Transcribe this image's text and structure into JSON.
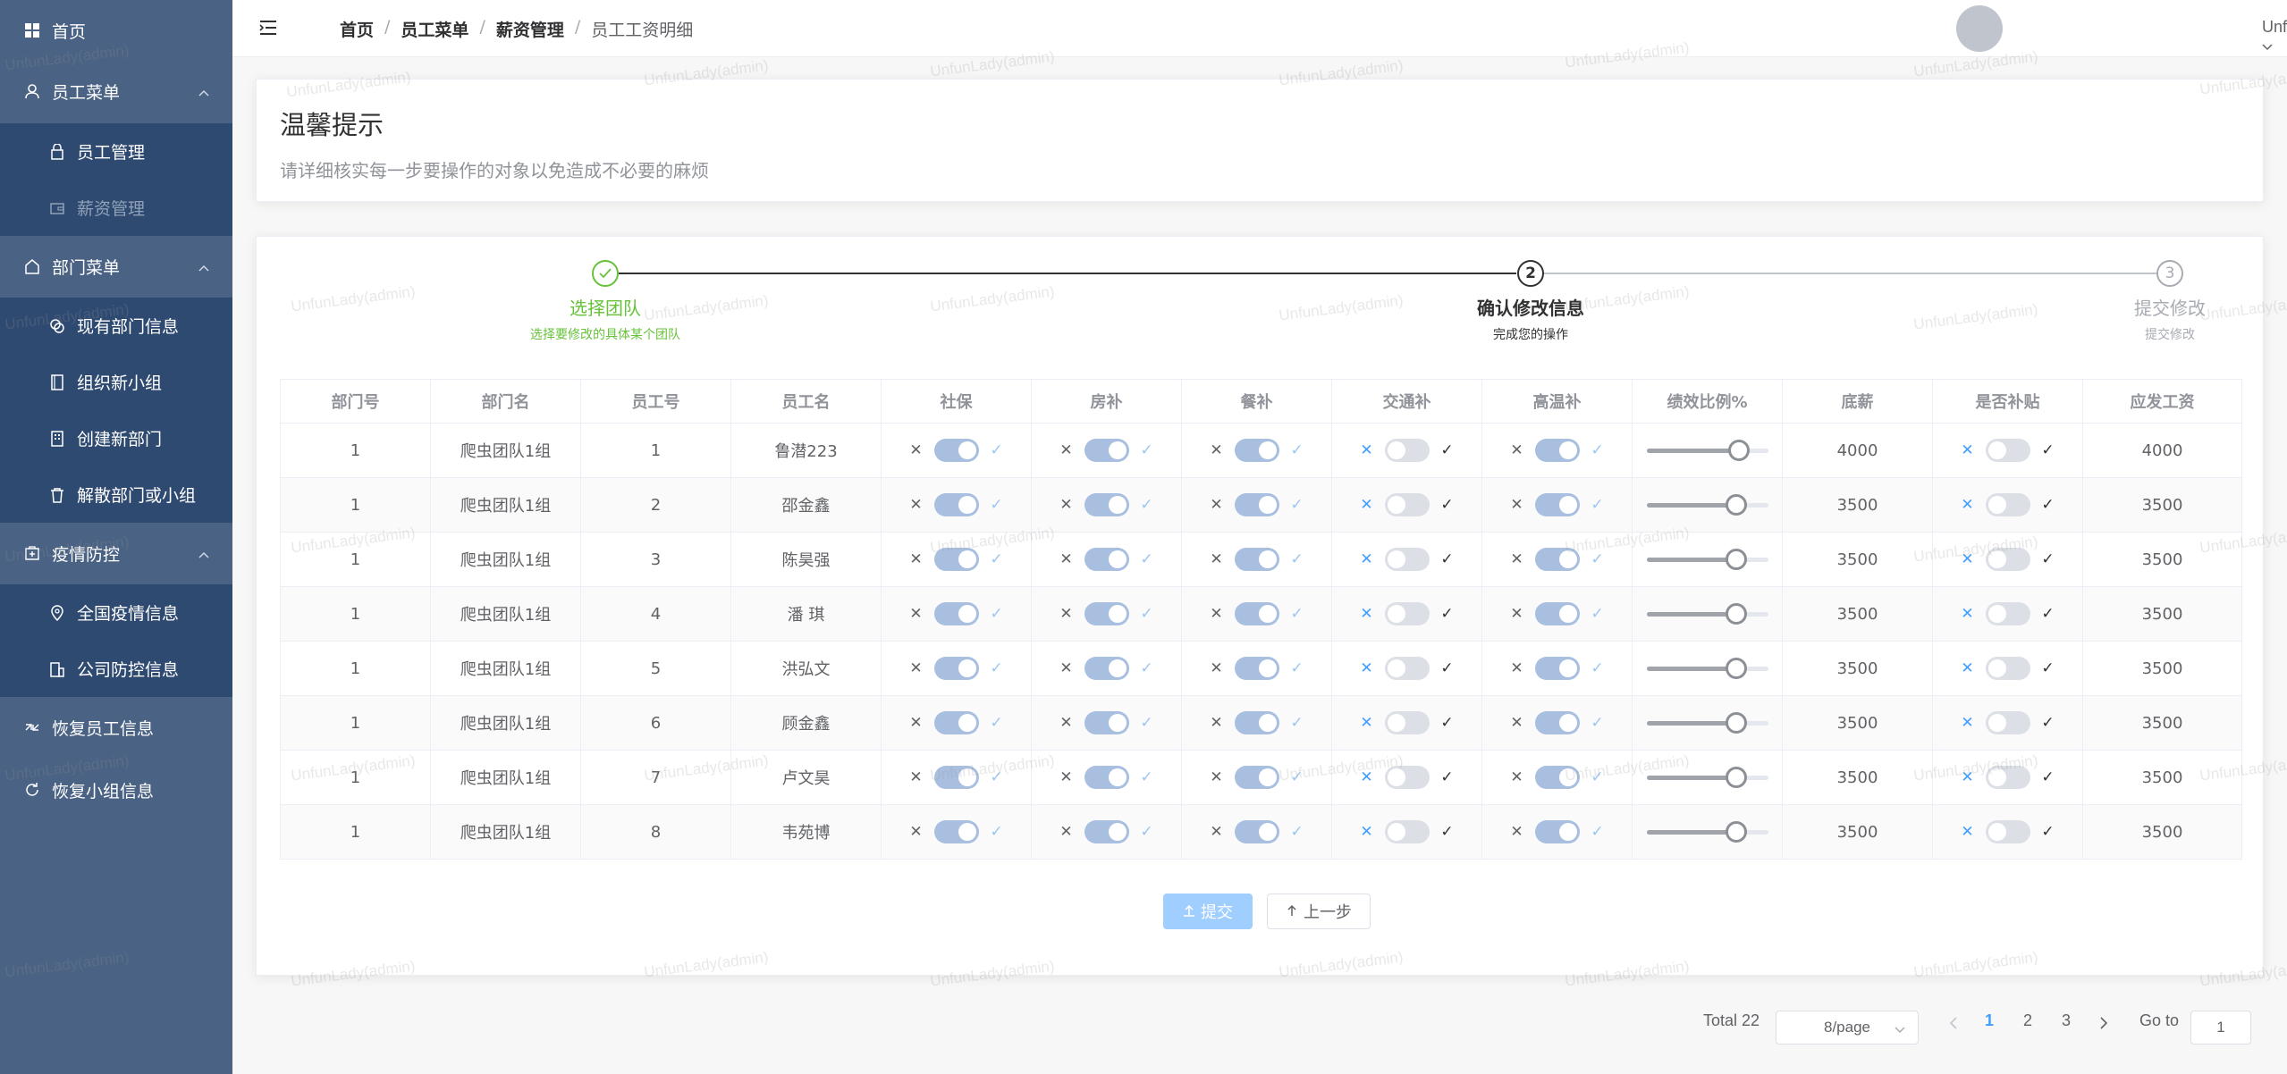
{
  "sidebar": {
    "items": [
      {
        "label": "首页",
        "icon": "grid-icon"
      },
      {
        "label": "员工菜单",
        "icon": "user-icon"
      },
      {
        "label": "员工管理",
        "icon": "lock-icon"
      },
      {
        "label": "薪资管理",
        "icon": "wallet-icon"
      },
      {
        "label": "部门菜单",
        "icon": "home-icon"
      },
      {
        "label": "现有部门信息",
        "icon": "coin-icon"
      },
      {
        "label": "组织新小组",
        "icon": "book-icon"
      },
      {
        "label": "创建新部门",
        "icon": "building-icon"
      },
      {
        "label": "解散部门或小组",
        "icon": "trash-icon"
      },
      {
        "label": "疫情防控",
        "icon": "medical-box-icon"
      },
      {
        "label": "全国疫情信息",
        "icon": "location-icon"
      },
      {
        "label": "公司防控信息",
        "icon": "office-icon"
      },
      {
        "label": "恢复员工信息",
        "icon": "share-icon"
      },
      {
        "label": "恢复小组信息",
        "icon": "refresh-icon"
      }
    ]
  },
  "watermark": "UnfunLady(admin)",
  "header": {
    "breadcrumb": [
      "首页",
      "员工菜单",
      "薪资管理",
      "员工工资明细"
    ],
    "separator": "/",
    "username": "UnfunLady"
  },
  "tip": {
    "title": "温馨提示",
    "text": "请详细核实每一步要操作的对象以免造成不必要的麻烦"
  },
  "steps": [
    {
      "number": "1",
      "title": "选择团队",
      "desc": "选择要修改的具体某个团队",
      "status": "success"
    },
    {
      "number": "2",
      "title": "确认修改信息",
      "desc": "完成您的操作",
      "status": "process"
    },
    {
      "number": "3",
      "title": "提交修改",
      "desc": "提交修改",
      "status": "wait"
    }
  ],
  "table": {
    "headers": [
      "部门号",
      "部门名",
      "员工号",
      "员工名",
      "社保",
      "房补",
      "餐补",
      "交通补",
      "高温补",
      "绩效比例%",
      "底薪",
      "是否补贴",
      "应发工资"
    ],
    "rows": [
      {
        "dept_no": "1",
        "dept_name": "爬虫团队1组",
        "emp_no": "1",
        "emp_name": "鲁潜223",
        "social": true,
        "housing": true,
        "meal": true,
        "transport": false,
        "heat": true,
        "perf": 0.76,
        "base": "4000",
        "subsidy": false,
        "pay": "4000"
      },
      {
        "dept_no": "1",
        "dept_name": "爬虫团队1组",
        "emp_no": "2",
        "emp_name": "邵金鑫",
        "social": true,
        "housing": true,
        "meal": true,
        "transport": false,
        "heat": true,
        "perf": 0.74,
        "base": "3500",
        "subsidy": false,
        "pay": "3500"
      },
      {
        "dept_no": "1",
        "dept_name": "爬虫团队1组",
        "emp_no": "3",
        "emp_name": "陈昊强",
        "social": true,
        "housing": true,
        "meal": true,
        "transport": false,
        "heat": true,
        "perf": 0.74,
        "base": "3500",
        "subsidy": false,
        "pay": "3500"
      },
      {
        "dept_no": "1",
        "dept_name": "爬虫团队1组",
        "emp_no": "4",
        "emp_name": "潘 琪",
        "social": true,
        "housing": true,
        "meal": true,
        "transport": false,
        "heat": true,
        "perf": 0.74,
        "base": "3500",
        "subsidy": false,
        "pay": "3500"
      },
      {
        "dept_no": "1",
        "dept_name": "爬虫团队1组",
        "emp_no": "5",
        "emp_name": "洪弘文",
        "social": true,
        "housing": true,
        "meal": true,
        "transport": false,
        "heat": true,
        "perf": 0.74,
        "base": "3500",
        "subsidy": false,
        "pay": "3500"
      },
      {
        "dept_no": "1",
        "dept_name": "爬虫团队1组",
        "emp_no": "6",
        "emp_name": "顾金鑫",
        "social": true,
        "housing": true,
        "meal": true,
        "transport": false,
        "heat": true,
        "perf": 0.74,
        "base": "3500",
        "subsidy": false,
        "pay": "3500"
      },
      {
        "dept_no": "1",
        "dept_name": "爬虫团队1组",
        "emp_no": "7",
        "emp_name": "卢文昊",
        "social": true,
        "housing": true,
        "meal": true,
        "transport": false,
        "heat": true,
        "perf": 0.74,
        "base": "3500",
        "subsidy": false,
        "pay": "3500"
      },
      {
        "dept_no": "1",
        "dept_name": "爬虫团队1组",
        "emp_no": "8",
        "emp_name": "韦苑博",
        "social": true,
        "housing": true,
        "meal": true,
        "transport": false,
        "heat": true,
        "perf": 0.74,
        "base": "3500",
        "subsidy": false,
        "pay": "3500"
      }
    ]
  },
  "switch_glyphs": {
    "off": "✕",
    "on": "✓"
  },
  "buttons": {
    "submit": "提交",
    "prev": "上一步"
  },
  "pagination": {
    "total": "Total 22",
    "page_size": "8/page",
    "pages": [
      "1",
      "2",
      "3"
    ],
    "current": "1",
    "goto_label": "Go to",
    "goto_value": "1"
  },
  "colors": {
    "sidebar": "#4a6283",
    "sidebar_sub": "#2f4a71",
    "success": "#67c23a",
    "primary": "#409eff"
  }
}
